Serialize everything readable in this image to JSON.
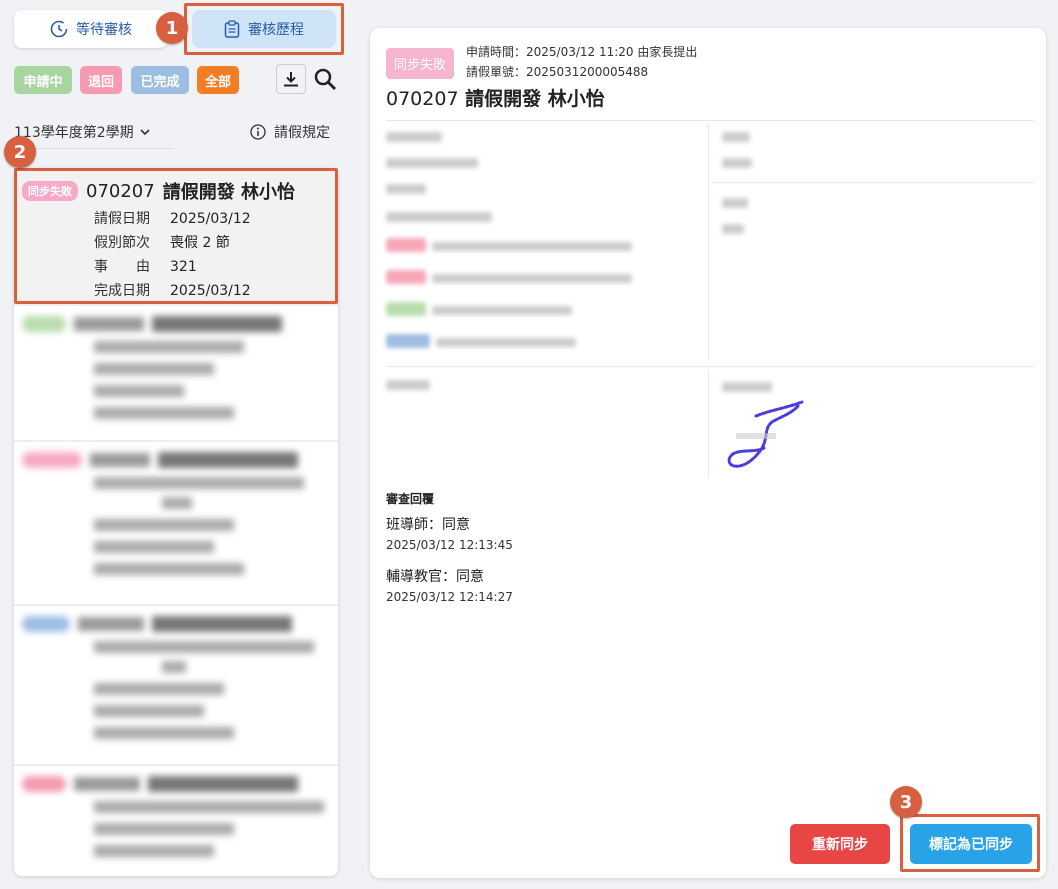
{
  "tabs": {
    "pending": "等待審核",
    "history": "審核歷程"
  },
  "steps": [
    "1",
    "2",
    "3"
  ],
  "filters": [
    {
      "label": "申請中",
      "color": "#a8d4a0"
    },
    {
      "label": "退回",
      "color": "#f59ab0"
    },
    {
      "label": "已完成",
      "color": "#9dbde2"
    },
    {
      "label": "全部",
      "color": "#f37d22"
    }
  ],
  "term": "113學年度第2學期",
  "rules_label": "請假規定",
  "list": {
    "selected": {
      "badge": "同步失敗",
      "badge_color": "#f7a9c6",
      "code": "070207",
      "title": "請假開發 林小怡",
      "rows": [
        {
          "label": "請假日期",
          "value": "2025/03/12"
        },
        {
          "label": "假別節次",
          "value": "喪假 2 節"
        },
        {
          "label": "事　　由",
          "value": "321"
        },
        {
          "label": "完成日期",
          "value": "2025/03/12"
        }
      ]
    }
  },
  "detail": {
    "badge": "同步失敗",
    "apply_time": "申請時間：2025/03/12 11:20 由家長提出",
    "form_no": "請假單號：2025031200005488",
    "code": "070207",
    "title": "請假開發 林小怡",
    "review_head": "審查回覆",
    "reviews": [
      {
        "name": "班導師：同意",
        "time": "2025/03/12 12:13:45"
      },
      {
        "name": "輔導教官：同意",
        "time": "2025/03/12 12:14:27"
      }
    ],
    "btn_resync": "重新同步",
    "btn_mark": "標記為已同步"
  }
}
